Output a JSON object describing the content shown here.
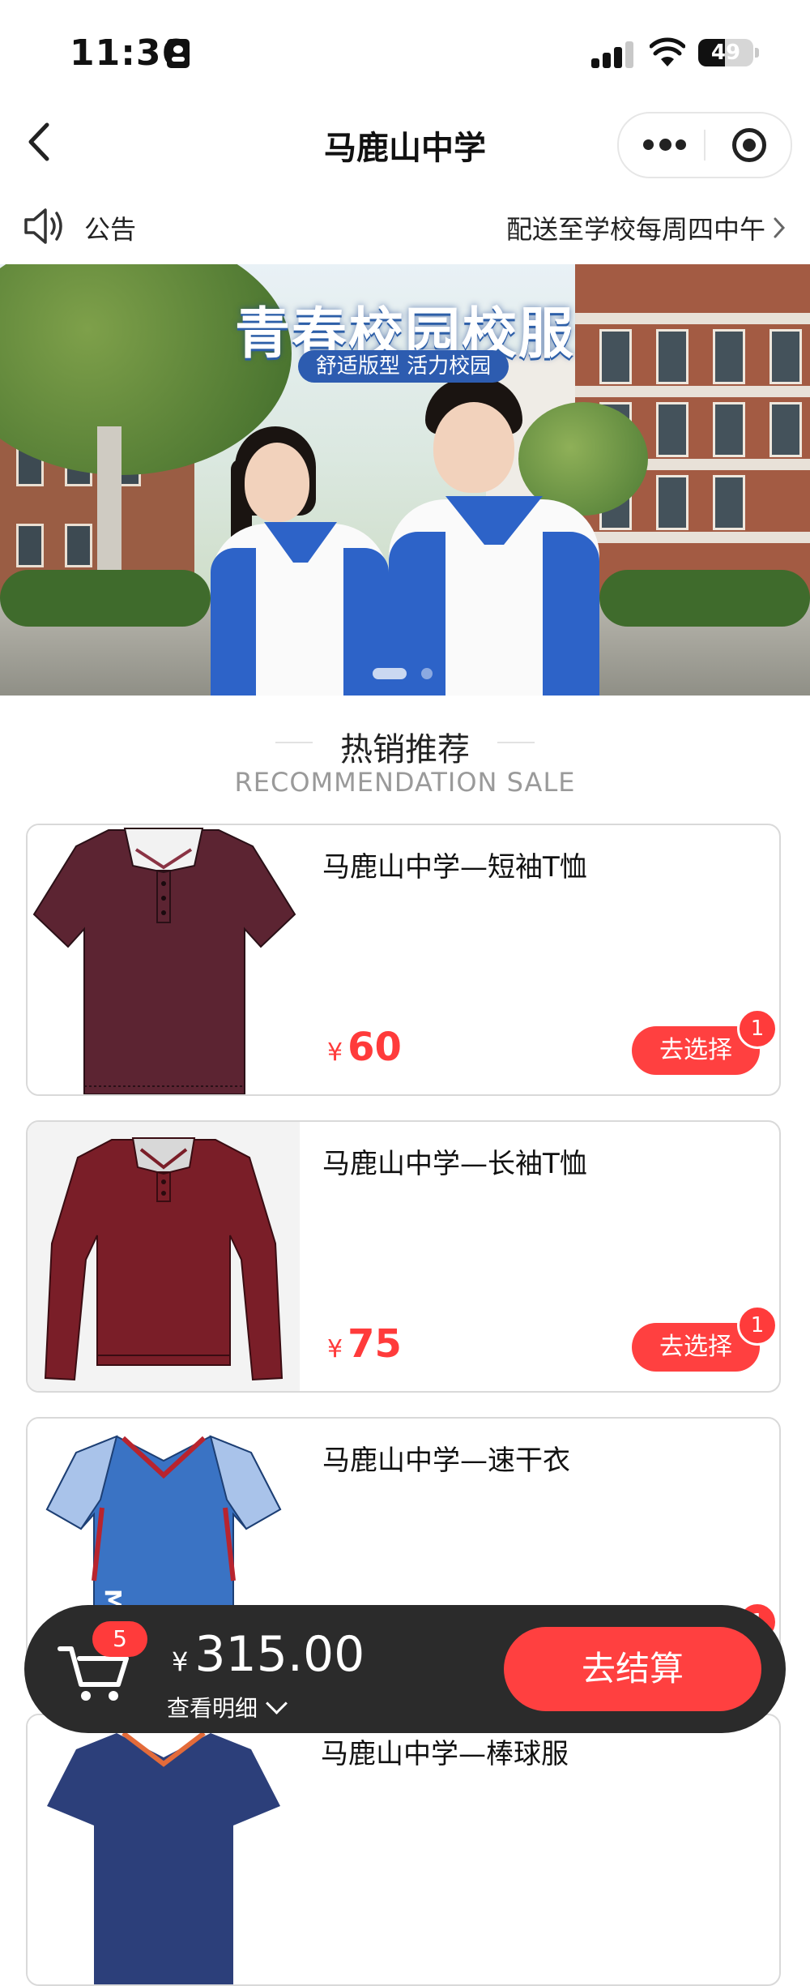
{
  "status_bar": {
    "time": "11:36",
    "battery": "49",
    "battery_level": 0.49
  },
  "nav": {
    "title": "马鹿山中学"
  },
  "notice": {
    "label": "公告",
    "text": "配送至学校每周四中午"
  },
  "banner": {
    "title": "青春校园校服",
    "subtitle": "舒适版型 活力校园",
    "slide_count": 2,
    "active_slide": 1
  },
  "section": {
    "title": "热销推荐",
    "subtitle": "RECOMMENDATION SALE"
  },
  "products": [
    {
      "name": "马鹿山中学—短袖T恤",
      "currency": "¥",
      "price": "60",
      "button": "去选择",
      "count": "1",
      "color": "#5c2432"
    },
    {
      "name": "马鹿山中学—长袖T恤",
      "currency": "¥",
      "price": "75",
      "button": "去选择",
      "count": "1",
      "color": "#7a1e28"
    },
    {
      "name": "马鹿山中学—速干衣",
      "currency": "¥",
      "price": "",
      "button": "",
      "count": "1",
      "color": "#3a73c4"
    },
    {
      "name": "马鹿山中学—棒球服"
    }
  ],
  "cart": {
    "badge": "5",
    "currency": "¥",
    "total": "315.00",
    "detail": "查看明细",
    "checkout": "去结算"
  },
  "colors": {
    "accent": "#ff4040",
    "cart_bar": "#2b2b2b"
  }
}
